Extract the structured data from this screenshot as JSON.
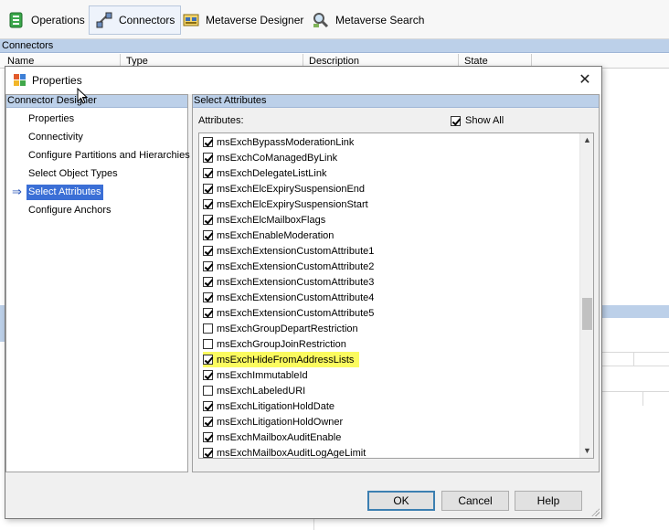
{
  "toolbar": {
    "buttons": [
      {
        "label": "Operations"
      },
      {
        "label": "Connectors"
      },
      {
        "label": "Metaverse Designer"
      },
      {
        "label": "Metaverse Search"
      }
    ]
  },
  "main": {
    "section_title": "Connectors",
    "columns": [
      "Name",
      "Type",
      "Description",
      "State"
    ]
  },
  "dialog": {
    "title": "Properties",
    "close_glyph": "✕",
    "left_pane": {
      "header": "Connector Designer",
      "items": [
        {
          "label": "Properties"
        },
        {
          "label": "Connectivity"
        },
        {
          "label": "Configure Partitions and Hierarchies"
        },
        {
          "label": "Select Object Types"
        },
        {
          "label": "Select Attributes"
        },
        {
          "label": "Configure Anchors"
        }
      ],
      "selected_arrow": "⇒"
    },
    "right_pane": {
      "header": "Select Attributes",
      "attributes_label": "Attributes:",
      "show_all_label": "Show All",
      "show_all_checked": true,
      "attributes": [
        {
          "name": "msExchBypassModerationLink",
          "checked": true
        },
        {
          "name": "msExchCoManagedByLink",
          "checked": true
        },
        {
          "name": "msExchDelegateListLink",
          "checked": true
        },
        {
          "name": "msExchElcExpirySuspensionEnd",
          "checked": true
        },
        {
          "name": "msExchElcExpirySuspensionStart",
          "checked": true
        },
        {
          "name": "msExchElcMailboxFlags",
          "checked": true
        },
        {
          "name": "msExchEnableModeration",
          "checked": true
        },
        {
          "name": "msExchExtensionCustomAttribute1",
          "checked": true
        },
        {
          "name": "msExchExtensionCustomAttribute2",
          "checked": true
        },
        {
          "name": "msExchExtensionCustomAttribute3",
          "checked": true
        },
        {
          "name": "msExchExtensionCustomAttribute4",
          "checked": true
        },
        {
          "name": "msExchExtensionCustomAttribute5",
          "checked": true
        },
        {
          "name": "msExchGroupDepartRestriction",
          "checked": false
        },
        {
          "name": "msExchGroupJoinRestriction",
          "checked": false
        },
        {
          "name": "msExchHideFromAddressLists",
          "checked": true,
          "highlighted": true
        },
        {
          "name": "msExchImmutableId",
          "checked": true
        },
        {
          "name": "msExchLabeledURI",
          "checked": false
        },
        {
          "name": "msExchLitigationHoldDate",
          "checked": true
        },
        {
          "name": "msExchLitigationHoldOwner",
          "checked": true
        },
        {
          "name": "msExchMailboxAuditEnable",
          "checked": true
        },
        {
          "name": "msExchMailboxAuditLogAgeLimit",
          "checked": true
        }
      ]
    },
    "buttons": {
      "ok": "OK",
      "cancel": "Cancel",
      "help": "Help"
    }
  },
  "colors": {
    "header_blue": "#bcd0e9",
    "selection_blue": "#3b6fd6",
    "highlight_yellow": "#fbfb5f"
  }
}
